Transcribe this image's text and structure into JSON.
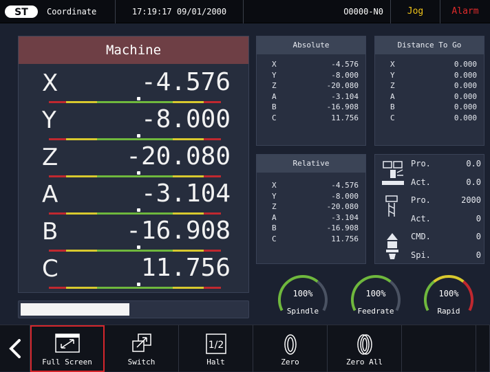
{
  "header": {
    "logo_icon": "brand-logo-icon",
    "screen_title": "Coordinate",
    "datetime": "17:19:17 09/01/2000",
    "program": "O0000-N0",
    "mode": "Jog",
    "alarm": "Alarm",
    "colors": {
      "mode": "#f0c419",
      "alarm": "#e02b2b"
    }
  },
  "machine": {
    "title": "Machine",
    "axes": [
      {
        "label": "X",
        "value": "-4.576",
        "marker": 0.52
      },
      {
        "label": "Y",
        "value": "-8.000",
        "marker": 0.52
      },
      {
        "label": "Z",
        "value": "-20.080",
        "marker": 0.52
      },
      {
        "label": "A",
        "value": "-3.104",
        "marker": 0.52
      },
      {
        "label": "B",
        "value": "-16.908",
        "marker": 0.52
      },
      {
        "label": "C",
        "value": "11.756",
        "marker": 0.52
      }
    ],
    "progress_fraction": 0.48
  },
  "absolute": {
    "title": "Absolute",
    "rows": [
      {
        "axis": "X",
        "value": "-4.576"
      },
      {
        "axis": "Y",
        "value": "-8.000"
      },
      {
        "axis": "Z",
        "value": "-20.080"
      },
      {
        "axis": "A",
        "value": "-3.104"
      },
      {
        "axis": "B",
        "value": "-16.908"
      },
      {
        "axis": "C",
        "value": "11.756"
      }
    ]
  },
  "distance_to_go": {
    "title": "Distance To Go",
    "rows": [
      {
        "axis": "X",
        "value": "0.000"
      },
      {
        "axis": "Y",
        "value": "0.000"
      },
      {
        "axis": "Z",
        "value": "0.000"
      },
      {
        "axis": "A",
        "value": "0.000"
      },
      {
        "axis": "B",
        "value": "0.000"
      },
      {
        "axis": "C",
        "value": "0.000"
      }
    ]
  },
  "relative": {
    "title": "Relative",
    "rows": [
      {
        "axis": "X",
        "value": "-4.576"
      },
      {
        "axis": "Y",
        "value": "-8.000"
      },
      {
        "axis": "Z",
        "value": "-20.080"
      },
      {
        "axis": "A",
        "value": "-3.104"
      },
      {
        "axis": "B",
        "value": "-16.908"
      },
      {
        "axis": "C",
        "value": "11.756"
      }
    ]
  },
  "status": {
    "rows": [
      {
        "key": "Pro.",
        "value": "0.0"
      },
      {
        "key": "Act.",
        "value": "0.0"
      },
      {
        "key": "Pro.",
        "value": "2000"
      },
      {
        "key": "Act.",
        "value": "0"
      },
      {
        "key": "CMD.",
        "value": "0"
      },
      {
        "key": "Spi.",
        "value": "0"
      }
    ],
    "icons": [
      "feed-machine-icon",
      "tool-holder-icon",
      "spindle-icon"
    ]
  },
  "gauges": [
    {
      "label": "Spindle",
      "percent": "100%",
      "fill": 1.0
    },
    {
      "label": "Feedrate",
      "percent": "100%",
      "fill": 1.0
    },
    {
      "label": "Rapid",
      "percent": "100%",
      "fill": 1.0
    }
  ],
  "toolbar": {
    "back_icon": "chevron-left-icon",
    "buttons": [
      {
        "label": "Full Screen",
        "icon": "full-screen-icon",
        "selected": true
      },
      {
        "label": "Switch",
        "icon": "switch-icon",
        "selected": false
      },
      {
        "label": "Halt",
        "icon": "halt-icon",
        "selected": false
      },
      {
        "label": "Zero",
        "icon": "zero-icon",
        "selected": false
      },
      {
        "label": "Zero All",
        "icon": "zero-all-icon",
        "selected": false
      }
    ],
    "halt_fraction": "1/2",
    "selected_color": "#d6262c"
  }
}
